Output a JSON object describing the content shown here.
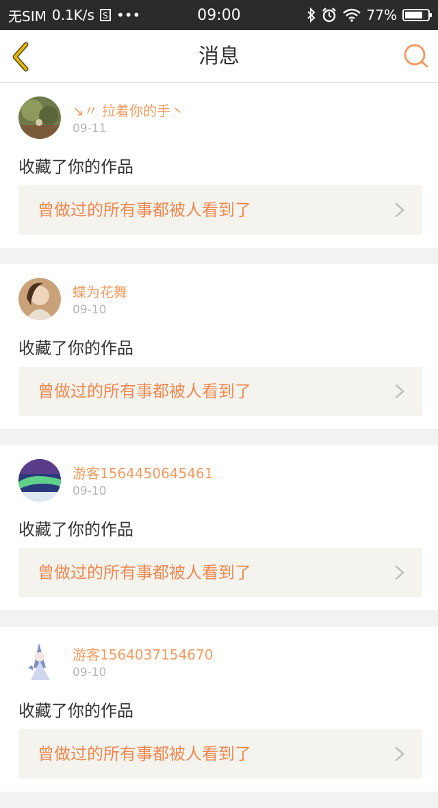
{
  "status_bar": {
    "carrier": "无SIM",
    "speed": "0.1K/s",
    "s_icon_label": "S",
    "dots": "•••",
    "time": "09:00",
    "battery": "77%",
    "battery_level": 0.77
  },
  "nav": {
    "title": "消息",
    "back_icon": "chevron-left-icon",
    "search_icon": "search-icon"
  },
  "messages": [
    {
      "user": "↘〃 拉着你的手丶",
      "date": "09-11",
      "action": "收藏了你的作品",
      "work_title": "曾做过的所有事都被人看到了"
    },
    {
      "user": "蝶为花舞",
      "date": "09-10",
      "action": "收藏了你的作品",
      "work_title": "曾做过的所有事都被人看到了"
    },
    {
      "user": "游客1564450645461",
      "date": "09-10",
      "action": "收藏了你的作品",
      "work_title": "曾做过的所有事都被人看到了"
    },
    {
      "user": "游客1564037154670",
      "date": "09-10",
      "action": "收藏了你的作品",
      "work_title": "曾做过的所有事都被人看到了"
    }
  ],
  "colors": {
    "accent": "#f0884f",
    "back_arrow": "#e8b400",
    "link_bg": "#f4f3ee"
  }
}
